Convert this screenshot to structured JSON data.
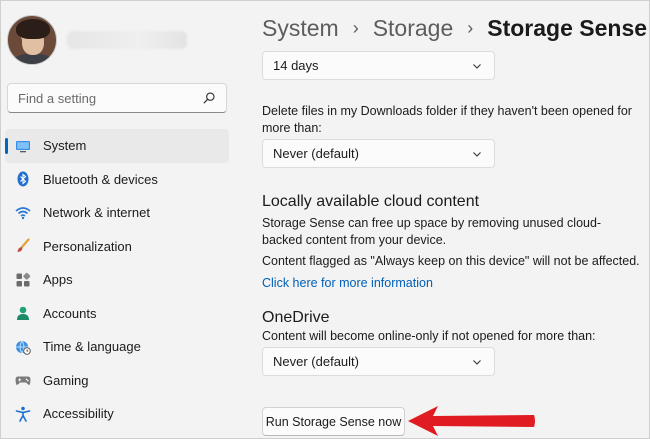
{
  "sidebar": {
    "search": {
      "placeholder": "Find a setting"
    },
    "items": [
      {
        "label": "System",
        "icon": "system-icon",
        "active": true
      },
      {
        "label": "Bluetooth & devices",
        "icon": "bluetooth-icon"
      },
      {
        "label": "Network & internet",
        "icon": "wifi-icon"
      },
      {
        "label": "Personalization",
        "icon": "brush-icon"
      },
      {
        "label": "Apps",
        "icon": "apps-icon"
      },
      {
        "label": "Accounts",
        "icon": "accounts-icon"
      },
      {
        "label": "Time & language",
        "icon": "globe-clock-icon"
      },
      {
        "label": "Gaming",
        "icon": "gamepad-icon"
      },
      {
        "label": "Accessibility",
        "icon": "accessibility-icon"
      }
    ]
  },
  "breadcrumb": {
    "items": [
      "System",
      "Storage"
    ],
    "current": "Storage Sense",
    "separator": "›"
  },
  "main": {
    "top_dropdown_value": "14 days",
    "downloads_label": "Delete files in my Downloads folder if they haven't been opened for more than:",
    "downloads_dropdown_value": "Never (default)",
    "cloud_heading": "Locally available cloud content",
    "cloud_desc": "Storage Sense can free up space by removing unused cloud-backed content from your device.",
    "cloud_note": "Content flagged as \"Always keep on this device\" will not be affected.",
    "more_info_link": "Click here for more information",
    "onedrive_heading": "OneDrive",
    "onedrive_label": "Content will become online-only if not opened for more than:",
    "onedrive_dropdown_value": "Never (default)",
    "run_button": "Run Storage Sense now"
  },
  "colors": {
    "accent": "#0067c0",
    "link": "#005fb8",
    "arrow": "#e11b22",
    "background": "#f3f3f3"
  }
}
